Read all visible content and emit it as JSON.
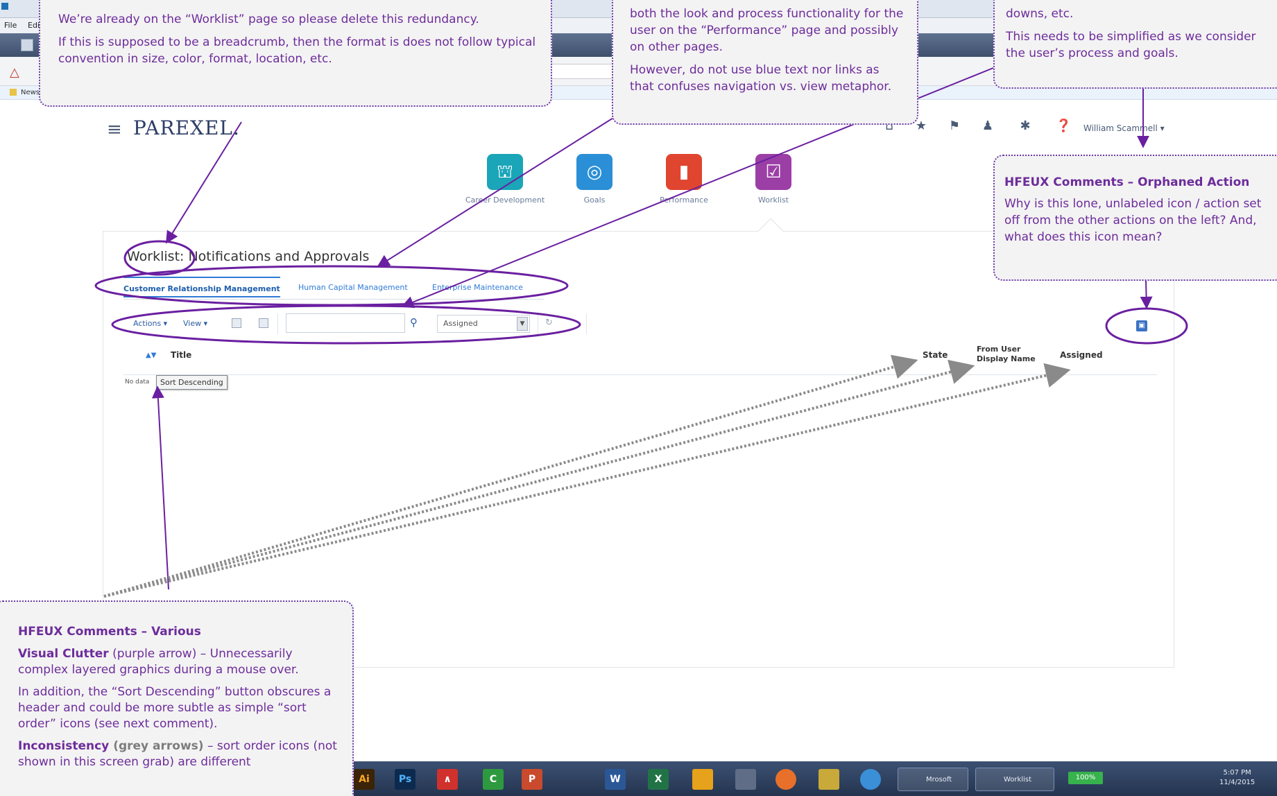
{
  "browser": {
    "menu": [
      "File",
      "Edit"
    ],
    "favorites": [
      "News"
    ]
  },
  "header": {
    "brand": "PAREXEL.",
    "username": "William Scammell ▾"
  },
  "tiles": [
    {
      "label": "Career Development",
      "color": "#1aa5b8",
      "icon": "signpost-icon"
    },
    {
      "label": "Goals",
      "color": "#2a8fd6",
      "icon": "target-icon"
    },
    {
      "label": "Performance",
      "color": "#e0452f",
      "icon": "bar-chart-icon"
    },
    {
      "label": "Worklist",
      "color": "#9b3fa6",
      "icon": "clipboard-check-icon"
    }
  ],
  "page": {
    "title": "Worklist: Notifications and Approvals",
    "tabs": [
      "Customer Relationship Management",
      "Human Capital Management",
      "Enterprise Maintenance"
    ],
    "toolbar": {
      "actions": "Actions ▾",
      "view": "View ▾",
      "filter_value": "Assigned"
    },
    "columns": {
      "title": "Title",
      "state": "State",
      "from_user": "From User\nDisplay Name",
      "assigned": "Assigned"
    },
    "no_data": "No data",
    "sort_tooltip": "Sort Descending"
  },
  "taskbar": {
    "apps": [
      {
        "glyph": "Ai",
        "color": "#3b2407"
      },
      {
        "glyph": "Ps",
        "color": "#0c2a4d"
      },
      {
        "glyph": "∧",
        "color": "#d0312d"
      },
      {
        "glyph": "C",
        "color": "#2e9a3f"
      },
      {
        "glyph": "P",
        "color": "#c94a2c"
      },
      {
        "glyph": "W",
        "color": "#2b5797"
      },
      {
        "glyph": "X",
        "color": "#217346"
      }
    ],
    "windows": [
      "Mrosoft",
      "Worklist"
    ],
    "battery": "100%",
    "time": "5:07 PM",
    "date": "11/4/2015"
  },
  "callouts": {
    "redundancy": {
      "p1": "We’re already on the “Worklist” page so please delete this redundancy.",
      "p2": "If this is supposed to be a breadcrumb, then the format is does not follow typical convention in size, color, format, location, etc."
    },
    "tabs": {
      "p1": "both the look and process functionality for the user on the “Performance” page and possibly on other pages.",
      "p2": "However, do not use blue text nor links as that confuses navigation vs. view metaphor."
    },
    "toolbar": {
      "p1": "downs, etc.",
      "p2": "This needs to be simplified as we consider the user’s process and goals."
    },
    "orphan": {
      "title": "HFEUX Comments – Orphaned Action",
      "p1": "Why is this lone, unlabeled icon /  action set off from the other actions on the left? And, what does this icon mean?"
    },
    "various": {
      "title": "HFEUX Comments – Various",
      "p1_bold": "Visual Clutter",
      "p1_rest": " (purple arrow) – Unnecessarily complex layered graphics during a mouse over.",
      "p2": "In addition, the “Sort Descending” button obscures a header and could be more subtle as simple “sort order” icons (see next comment).",
      "p3_bold": "Inconsistency",
      "p3_grey": " (grey arrows)",
      "p3_rest": " – sort order icons (not shown in this screen grab) are different"
    }
  }
}
